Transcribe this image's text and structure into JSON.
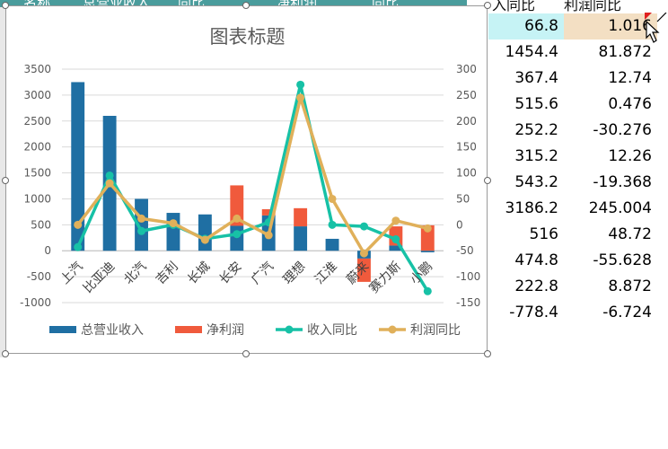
{
  "sheet": {
    "header_cells": [
      "...名称",
      "总营业收入",
      "同比",
      "净利润",
      "同比"
    ],
    "right_headers": [
      "入同比",
      "利润同比"
    ],
    "rows": [
      {
        "revenue_yoy": "66.8",
        "profit_yoy": "1.016"
      },
      {
        "revenue_yoy": "1454.4",
        "profit_yoy": "81.872"
      },
      {
        "revenue_yoy": "367.4",
        "profit_yoy": "12.74"
      },
      {
        "revenue_yoy": "515.6",
        "profit_yoy": "0.476"
      },
      {
        "revenue_yoy": "252.2",
        "profit_yoy": "-30.276"
      },
      {
        "revenue_yoy": "315.2",
        "profit_yoy": "12.26"
      },
      {
        "revenue_yoy": "543.2",
        "profit_yoy": "-19.368"
      },
      {
        "revenue_yoy": "3186.2",
        "profit_yoy": "245.004"
      },
      {
        "revenue_yoy": "516",
        "profit_yoy": "48.72"
      },
      {
        "revenue_yoy": "474.8",
        "profit_yoy": "-55.628"
      },
      {
        "revenue_yoy": "222.8",
        "profit_yoy": "8.872"
      },
      {
        "revenue_yoy": "-778.4",
        "profit_yoy": "-6.724"
      }
    ]
  },
  "chart_data": {
    "type": "bar",
    "title": "图表标题",
    "categories": [
      "上汽",
      "比亚迪",
      "北汽",
      "吉利",
      "长城",
      "长安",
      "广汽",
      "理想",
      "江淮",
      "蔚来",
      "赛力斯",
      "小鹏"
    ],
    "ylim": [
      -1000,
      3500
    ],
    "y_ticks": [
      3500,
      3000,
      2500,
      2000,
      1500,
      1000,
      500,
      0,
      -500,
      -1000
    ],
    "y2lim": [
      -150,
      300
    ],
    "y2_ticks": [
      300,
      250,
      200,
      150,
      100,
      50,
      0,
      -50,
      -100,
      -150
    ],
    "grid": true,
    "legend_position": "bottom",
    "series": [
      {
        "name": "总营业收入",
        "kind": "bar",
        "axis": "left",
        "color": "#1f6fa3",
        "values": [
          3250,
          2600,
          1000,
          730,
          700,
          480,
          680,
          470,
          230,
          -150,
          100,
          -30
        ]
      },
      {
        "name": "净利润",
        "kind": "bar",
        "axis": "left",
        "color": "#f05a3c",
        "values": [
          1210,
          1580,
          780,
          640,
          620,
          1260,
          800,
          820,
          0,
          -600,
          470,
          490
        ]
      },
      {
        "name": "收入同比",
        "kind": "line",
        "axis": "right",
        "color": "#17c1a6",
        "values": [
          -43,
          95,
          -12,
          0,
          -27,
          -18,
          5,
          270,
          0,
          -3,
          -28,
          -128
        ]
      },
      {
        "name": "利润同比",
        "kind": "line",
        "axis": "right",
        "color": "#e0b05a",
        "values": [
          0,
          80,
          12,
          3,
          -29,
          12,
          -20,
          245,
          50,
          -55,
          8,
          -7
        ]
      }
    ]
  }
}
